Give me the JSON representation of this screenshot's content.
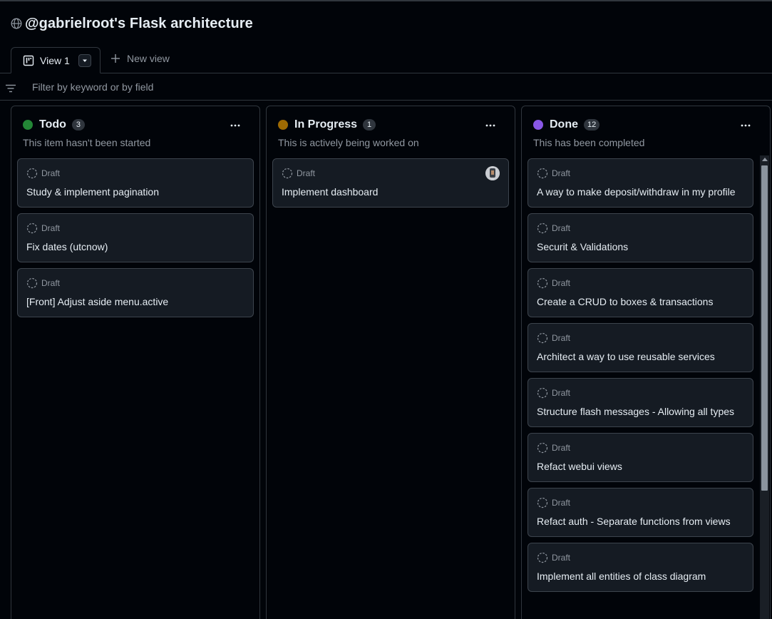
{
  "project": {
    "title": "@gabrielroot's Flask architecture",
    "visibility_icon": "globe-icon"
  },
  "tabs": {
    "active_label": "View 1",
    "active_icon": "board-icon",
    "menu_icon": "triangle-down-icon",
    "new_view_label": "New view",
    "new_view_icon": "plus-icon"
  },
  "filter": {
    "icon": "filter-icon",
    "placeholder": "Filter by keyword or by field",
    "value": ""
  },
  "columns": [
    {
      "name": "Todo",
      "count": "3",
      "color": "#238636",
      "description": "This item hasn't been started",
      "cards": [
        {
          "status": "Draft",
          "title": "Study & implement pagination"
        },
        {
          "status": "Draft",
          "title": "Fix dates (utcnow)"
        },
        {
          "status": "Draft",
          "title": "[Front] Adjust aside menu.active"
        }
      ]
    },
    {
      "name": "In Progress",
      "count": "1",
      "color": "#9e6a03",
      "description": "This is actively being worked on",
      "cards": [
        {
          "status": "Draft",
          "title": "Implement dashboard",
          "assignee_icon": "avatar-icon"
        }
      ]
    },
    {
      "name": "Done",
      "count": "12",
      "color": "#8957e5",
      "description": "This has been completed",
      "cards": [
        {
          "status": "Draft",
          "title": "A way to make deposit/withdraw in my profile"
        },
        {
          "status": "Draft",
          "title": "Securit & Validations"
        },
        {
          "status": "Draft",
          "title": "Create a CRUD to boxes & transactions"
        },
        {
          "status": "Draft",
          "title": "Architect a way to use reusable services"
        },
        {
          "status": "Draft",
          "title": "Structure flash messages - Allowing all types"
        },
        {
          "status": "Draft",
          "title": "Refact webui views"
        },
        {
          "status": "Draft",
          "title": "Refact auth - Separate functions from views"
        },
        {
          "status": "Draft",
          "title": "Implement all entities of class diagram"
        }
      ]
    }
  ],
  "colors": {
    "background": "#010409",
    "card": "#151b23",
    "border": "#30363d",
    "muted_text": "#9198a1"
  }
}
